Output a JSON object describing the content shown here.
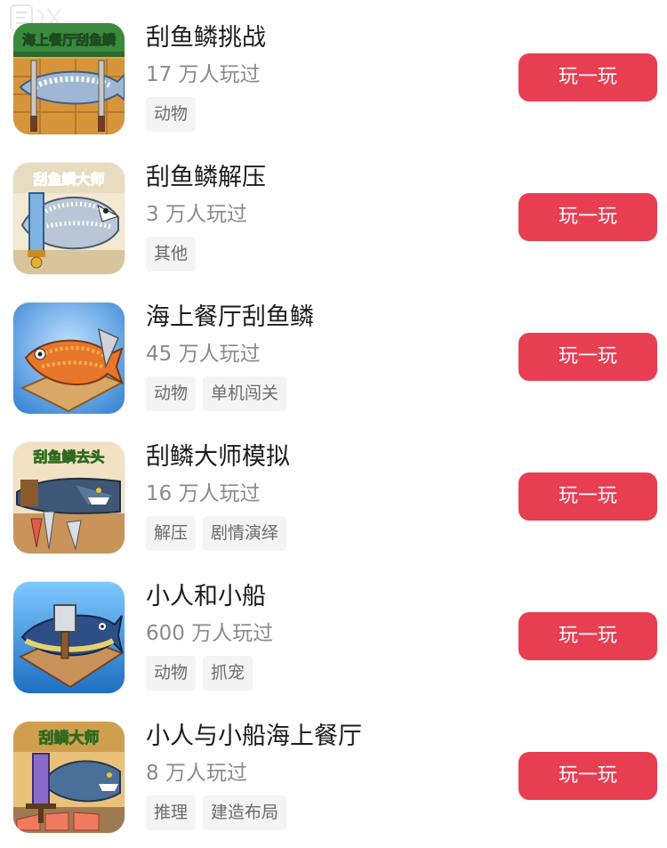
{
  "colors": {
    "accent": "#e83e52",
    "tag_bg": "#f4f4f4",
    "muted_text": "#8a8a8a"
  },
  "games": [
    {
      "icon": "fish-scaling-challenge-icon",
      "icon_banner": "海上餐厅刮鱼鳞",
      "title": "刮鱼鳞挑战",
      "players": "17 万人玩过",
      "tags": [
        "动物"
      ],
      "button": "玩一玩"
    },
    {
      "icon": "fish-scaling-master-icon",
      "icon_banner": "刮鱼鳞大师",
      "title": "刮鱼鳞解压",
      "players": "3 万人玩过",
      "tags": [
        "其他"
      ],
      "button": "玩一玩"
    },
    {
      "icon": "grilled-fish-icon",
      "icon_banner": "",
      "title": "海上餐厅刮鱼鳞",
      "players": "45 万人玩过",
      "tags": [
        "动物",
        "单机闯关"
      ],
      "button": "玩一玩"
    },
    {
      "icon": "shark-chef-icon",
      "icon_banner": "刮鱼鳞去头",
      "title": "刮鳞大师模拟",
      "players": "16 万人玩过",
      "tags": [
        "解压",
        "剧情演绎"
      ],
      "button": "玩一玩"
    },
    {
      "icon": "tuna-cleaver-icon",
      "icon_banner": "",
      "title": "小人和小船",
      "players": "600 万人玩过",
      "tags": [
        "动物",
        "抓宠"
      ],
      "button": "玩一玩"
    },
    {
      "icon": "shark-sword-icon",
      "icon_banner": "刮鳞大师",
      "title": "小人与小船海上餐厅",
      "players": "8 万人玩过",
      "tags": [
        "推理",
        "建造布局"
      ],
      "button": "玩一玩"
    }
  ]
}
